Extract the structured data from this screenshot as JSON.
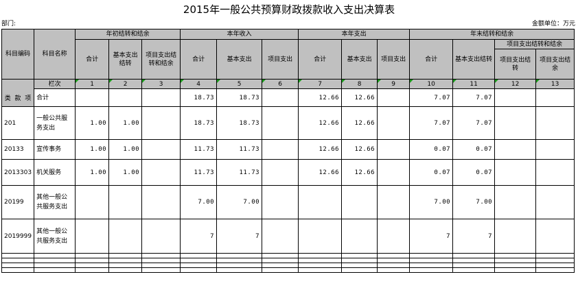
{
  "title": "2015年一般公共预算财政拨款收入支出决算表",
  "department_label": "部门:",
  "unit_label": "金额单位：万元",
  "headers": {
    "code": "科目编码",
    "name": "科目名称",
    "begin_balance": "年初结转和结余",
    "income": "本年收入",
    "expense": "本年支出",
    "end_balance": "年末结转和结余",
    "total": "合计",
    "basic": "基本支出",
    "basic_balance": "基本支出结转",
    "project_balance": "项目支出结转和结余",
    "project": "项目支出",
    "project_end_group": "项目支出结转和结余",
    "project_carry": "项目支出结转",
    "project_surplus": "项目支出结余",
    "row_no": "栏次",
    "sub_lei": "类",
    "sub_kuan": "款",
    "sub_xiang": "项"
  },
  "col_numbers": [
    "1",
    "2",
    "3",
    "4",
    "5",
    "6",
    "7",
    "8",
    "9",
    "10",
    "11",
    "12",
    "13"
  ],
  "rows": [
    {
      "code": "",
      "name": "合计",
      "v": [
        "",
        "",
        "",
        "18.73",
        "18.73",
        "",
        "12.66",
        "12.66",
        "",
        "7.07",
        "7.07",
        "",
        ""
      ]
    },
    {
      "code": "201",
      "name": "一般公共服务支出",
      "v": [
        "1.00",
        "1.00",
        "",
        "18.73",
        "18.73",
        "",
        "12.66",
        "12.66",
        "",
        "7.07",
        "7.07",
        "",
        ""
      ]
    },
    {
      "code": "20133",
      "name": "宣传事务",
      "v": [
        "1.00",
        "1.00",
        "",
        "11.73",
        "11.73",
        "",
        "12.66",
        "12.66",
        "",
        "0.07",
        "0.07",
        "",
        ""
      ]
    },
    {
      "code": "2013303",
      "name": "机关服务",
      "v": [
        "1.00",
        "1.00",
        "",
        "11.73",
        "11.73",
        "",
        "12.66",
        "12.66",
        "",
        "0.07",
        "0.07",
        "",
        ""
      ]
    },
    {
      "code": "20199",
      "name": "其他一般公共服务支出",
      "v": [
        "",
        "",
        "",
        "7.00",
        "7.00",
        "",
        "",
        "",
        "",
        "7.00",
        "7.00",
        "",
        ""
      ]
    },
    {
      "code": "2019999",
      "name": "其他一般公共服务支出",
      "v": [
        "",
        "",
        "",
        "7",
        "7",
        "",
        "",
        "",
        "",
        "7",
        "7",
        "",
        ""
      ]
    }
  ]
}
